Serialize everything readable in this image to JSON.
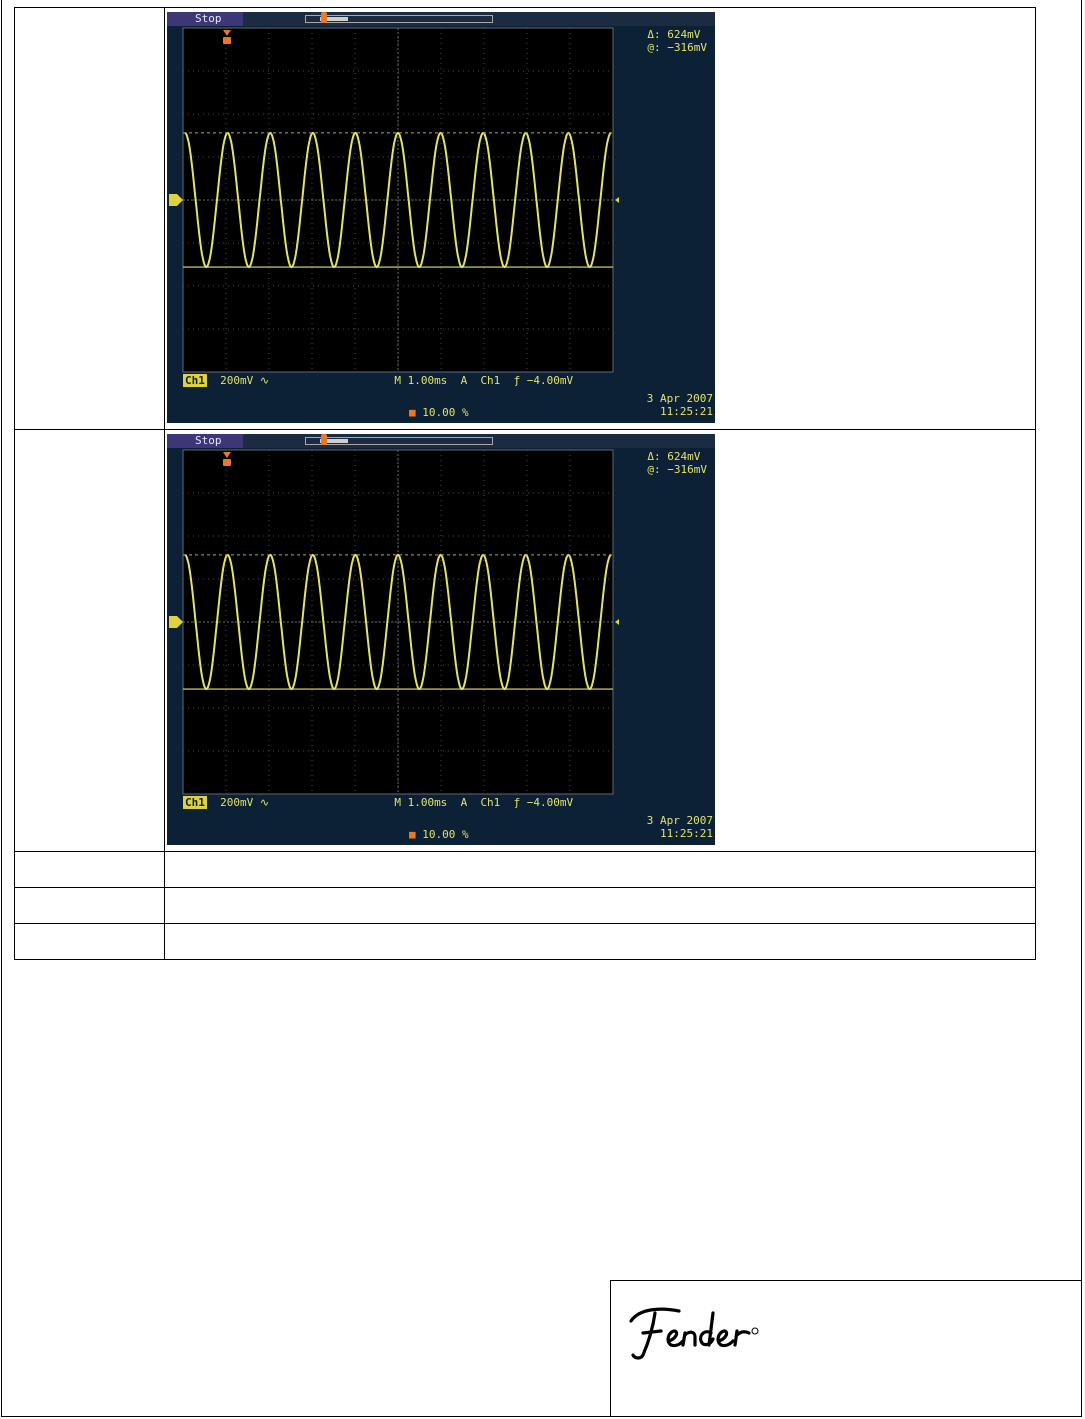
{
  "scope_capture": {
    "status": "Stop",
    "delta_label": "Δ:",
    "delta_value": "624mV",
    "at_label": "@:",
    "at_value": "−316mV",
    "channel": "Ch1",
    "vertical_scale": "200mV ∿",
    "timebase": "M 1.00ms",
    "trigger_mode": "A",
    "trigger_source": "Ch1",
    "trigger_level": "ƒ −4.00mV",
    "trigger_position": "10.00 %",
    "date": "3 Apr  2007",
    "time": "11:25:21",
    "trace_color": "#e3e36a",
    "background_color": "#0c2036"
  },
  "chart_data": {
    "type": "line",
    "series": [
      {
        "cycles_shown": 10,
        "peak_to_peak_mV": 624,
        "center_mV": 0
      }
    ],
    "time_per_div_ms": 1.0,
    "volts_per_div_mV": 200,
    "horizontal_divisions": 10,
    "vertical_divisions": 8,
    "grid": true
  },
  "logo": {
    "text": "Fender"
  }
}
